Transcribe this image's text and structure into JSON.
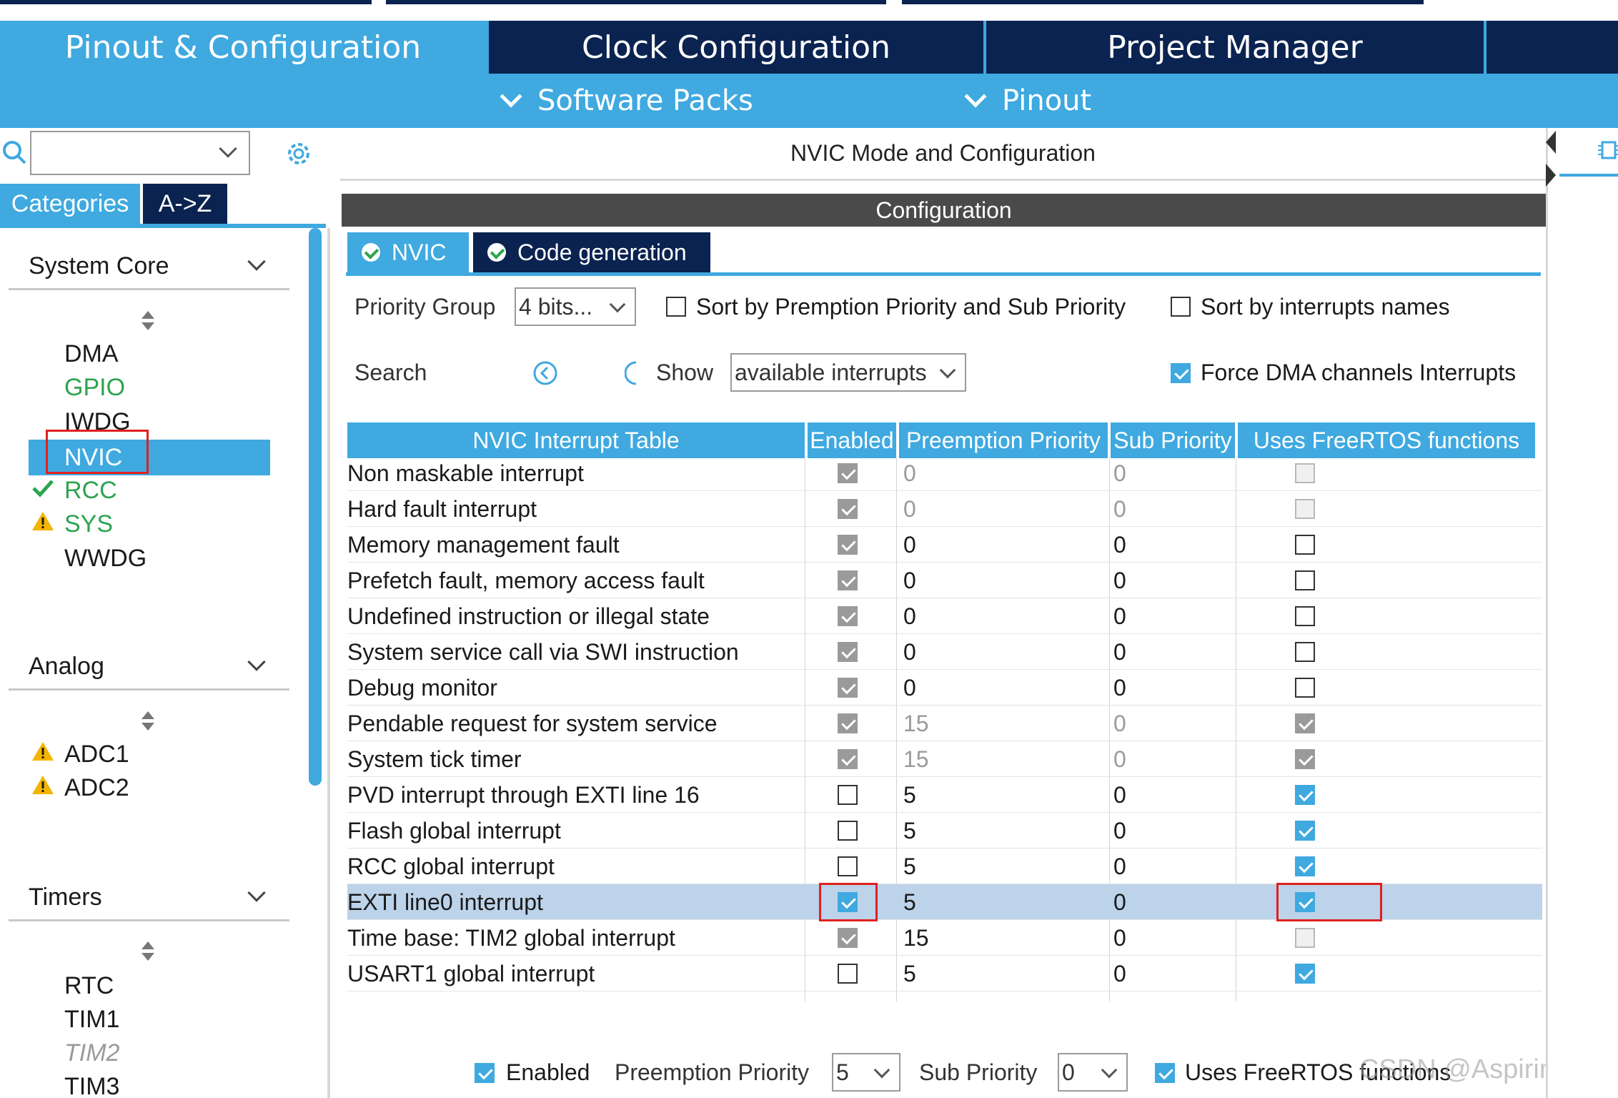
{
  "main_tabs": {
    "pinout": "Pinout & Configuration",
    "clock": "Clock Configuration",
    "project": "Project Manager"
  },
  "sub_tabs": {
    "software_packs": "Software Packs",
    "pinout": "Pinout"
  },
  "left": {
    "tab_categories": "Categories",
    "tab_az": "A->Z",
    "system_core": {
      "title": "System Core",
      "items": [
        "DMA",
        "GPIO",
        "IWDG",
        "NVIC",
        "RCC",
        "SYS",
        "WWDG"
      ]
    },
    "analog": {
      "title": "Analog",
      "items": [
        "ADC1",
        "ADC2"
      ]
    },
    "timers": {
      "title": "Timers",
      "items": [
        "RTC",
        "TIM1",
        "TIM2",
        "TIM3"
      ]
    }
  },
  "center": {
    "title": "NVIC Mode and Configuration",
    "config_bar": "Configuration",
    "tab_nvic": "NVIC",
    "tab_code": "Code generation",
    "priority_group_label": "Priority Group",
    "priority_group_value": "4 bits...",
    "sort_premption": "Sort by Premption Priority and Sub Priority",
    "sort_names": "Sort by interrupts names",
    "search_label": "Search",
    "show_label": "Show",
    "show_value": "available interrupts",
    "force_dma": "Force DMA channels Interrupts",
    "table_headers": {
      "name": "NVIC Interrupt Table",
      "enabled": "Enabled",
      "preemption": "Preemption Priority",
      "sub": "Sub Priority",
      "freertos": "Uses FreeRTOS functions"
    },
    "rows": [
      {
        "name": "Non maskable interrupt",
        "pre": "0",
        "sub": "0"
      },
      {
        "name": "Hard fault interrupt",
        "pre": "0",
        "sub": "0"
      },
      {
        "name": "Memory management fault",
        "pre": "0",
        "sub": "0"
      },
      {
        "name": "Prefetch fault, memory access fault",
        "pre": "0",
        "sub": "0"
      },
      {
        "name": "Undefined instruction or illegal state",
        "pre": "0",
        "sub": "0"
      },
      {
        "name": "System service call via SWI instruction",
        "pre": "0",
        "sub": "0"
      },
      {
        "name": "Debug monitor",
        "pre": "0",
        "sub": "0"
      },
      {
        "name": "Pendable request for system service",
        "pre": "15",
        "sub": "0"
      },
      {
        "name": "System tick timer",
        "pre": "15",
        "sub": "0"
      },
      {
        "name": "PVD interrupt through EXTI line 16",
        "pre": "5",
        "sub": "0"
      },
      {
        "name": "Flash global interrupt",
        "pre": "5",
        "sub": "0"
      },
      {
        "name": "RCC global interrupt",
        "pre": "5",
        "sub": "0"
      },
      {
        "name": "EXTI line0 interrupt",
        "pre": "5",
        "sub": "0"
      },
      {
        "name": "Time base: TIM2 global interrupt",
        "pre": "15",
        "sub": "0"
      },
      {
        "name": "USART1 global interrupt",
        "pre": "5",
        "sub": "0"
      }
    ],
    "bottom": {
      "enabled": "Enabled",
      "preemption_label": "Preemption Priority",
      "preemption_value": "5",
      "sub_label": "Sub Priority",
      "sub_value": "0",
      "freertos": "Uses FreeRTOS functions"
    },
    "watermark": "CSDN @Aspiring C"
  },
  "colors": {
    "accent_blue": "#3fa9e0",
    "navy": "#0b2350",
    "highlight_red": "#e02020"
  }
}
